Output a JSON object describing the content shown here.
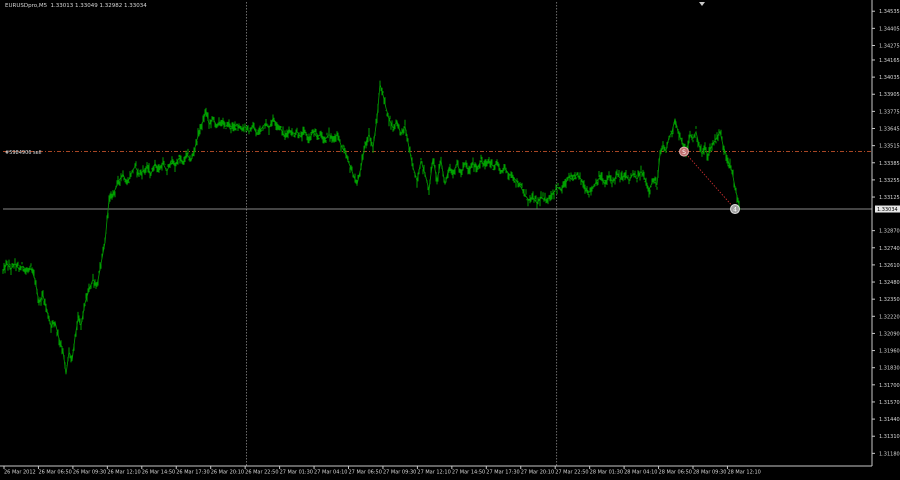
{
  "window": {
    "header": "EURUSDpro,M5  1.33013 1.33049 1.32982 1.33034",
    "order_label": "#5984906 sell",
    "current_price_label": "1.33034"
  },
  "colors": {
    "background": "#000000",
    "candles": "#00a000",
    "axis": "#c8c8c8",
    "text": "#d8d8d8",
    "order_line": "#c0502a",
    "grid": "#9a9a9a"
  },
  "chart_data": {
    "type": "line",
    "title": "",
    "xlabel": "",
    "ylabel": "",
    "ylim": [
      1.31084,
      1.34605
    ],
    "grid": false,
    "y_ticks": [
      "1.34535",
      "1.34405",
      "1.34275",
      "1.34165",
      "1.34035",
      "1.33905",
      "1.33775",
      "1.33645",
      "1.33515",
      "1.33385",
      "1.33255",
      "1.33125",
      "1.32870",
      "1.32740",
      "1.32610",
      "1.32480",
      "1.32350",
      "1.32220",
      "1.32090",
      "1.31960",
      "1.31830",
      "1.31700",
      "1.31570",
      "1.31440",
      "1.31310",
      "1.31180"
    ],
    "y_tick_values": [
      1.34535,
      1.34405,
      1.34275,
      1.34165,
      1.34035,
      1.33905,
      1.33775,
      1.33645,
      1.33515,
      1.33385,
      1.33255,
      1.33125,
      1.3287,
      1.3274,
      1.3261,
      1.3248,
      1.3235,
      1.3222,
      1.3209,
      1.3196,
      1.3183,
      1.317,
      1.3157,
      1.3144,
      1.3131,
      1.3118
    ],
    "x_ticks": [
      "26 Mar 2012",
      "26 Mar 06:50",
      "26 Mar 09:30",
      "26 Mar 12:10",
      "26 Mar 14:50",
      "26 Mar 17:30",
      "26 Mar 20:10",
      "26 Mar 22:50",
      "27 Mar 01:30",
      "27 Mar 04:10",
      "27 Mar 06:50",
      "27 Mar 09:30",
      "27 Mar 12:10",
      "27 Mar 14:50",
      "27 Mar 17:30",
      "27 Mar 20:10",
      "27 Mar 22:50",
      "28 Mar 01:30",
      "28 Mar 04:10",
      "28 Mar 06:50",
      "28 Mar 09:30",
      "28 Mar 12:10"
    ],
    "period_separators": [
      "26 Mar 22:50",
      "27 Mar 22:50"
    ],
    "order_price": 1.3347,
    "current_price": 1.33034,
    "order_open_marker": {
      "label": "S",
      "x": "28 Mar 08:30",
      "y": 1.3347
    },
    "order_close_marker": {
      "label": "4",
      "x": "28 Mar 12:10",
      "y": 1.33034
    },
    "series": [
      {
        "values": [
          [
            0,
            1.3256
          ],
          [
            4,
            1.3262
          ],
          [
            8,
            1.3258
          ],
          [
            12,
            1.3262
          ],
          [
            16,
            1.3258
          ],
          [
            20,
            1.326
          ],
          [
            24,
            1.3256
          ],
          [
            28,
            1.3258
          ],
          [
            32,
            1.325
          ],
          [
            36,
            1.3232
          ],
          [
            40,
            1.3238
          ],
          [
            44,
            1.3226
          ],
          [
            48,
            1.3215
          ],
          [
            52,
            1.3218
          ],
          [
            56,
            1.3205
          ],
          [
            60,
            1.3196
          ],
          [
            63,
            1.3178
          ],
          [
            66,
            1.3195
          ],
          [
            69,
            1.3188
          ],
          [
            72,
            1.3206
          ],
          [
            75,
            1.322
          ],
          [
            78,
            1.3215
          ],
          [
            82,
            1.3232
          ],
          [
            86,
            1.3242
          ],
          [
            90,
            1.325
          ],
          [
            94,
            1.3245
          ],
          [
            98,
            1.3262
          ],
          [
            102,
            1.3278
          ],
          [
            104,
            1.3295
          ],
          [
            106,
            1.331
          ],
          [
            108,
            1.3312
          ],
          [
            112,
            1.3318
          ],
          [
            116,
            1.3325
          ],
          [
            120,
            1.333
          ],
          [
            124,
            1.3322
          ],
          [
            128,
            1.333
          ],
          [
            132,
            1.3336
          ],
          [
            136,
            1.333
          ],
          [
            140,
            1.3332
          ],
          [
            144,
            1.3335
          ],
          [
            148,
            1.333
          ],
          [
            152,
            1.3338
          ],
          [
            156,
            1.3333
          ],
          [
            160,
            1.3338
          ],
          [
            164,
            1.3332
          ],
          [
            168,
            1.334
          ],
          [
            172,
            1.3336
          ],
          [
            176,
            1.3342
          ],
          [
            180,
            1.3338
          ],
          [
            184,
            1.3345
          ],
          [
            188,
            1.334
          ],
          [
            192,
            1.335
          ],
          [
            196,
            1.3362
          ],
          [
            200,
            1.337
          ],
          [
            203,
            1.3378
          ],
          [
            206,
            1.3368
          ],
          [
            210,
            1.3372
          ],
          [
            214,
            1.3366
          ],
          [
            218,
            1.337
          ],
          [
            222,
            1.3366
          ],
          [
            226,
            1.3368
          ],
          [
            230,
            1.3364
          ],
          [
            234,
            1.3368
          ],
          [
            238,
            1.3364
          ],
          [
            242,
            1.3366
          ],
          [
            246,
            1.3362
          ],
          [
            250,
            1.3366
          ],
          [
            254,
            1.336
          ],
          [
            258,
            1.3364
          ],
          [
            262,
            1.3368
          ],
          [
            266,
            1.3365
          ],
          [
            270,
            1.3372
          ],
          [
            274,
            1.3368
          ],
          [
            278,
            1.3364
          ],
          [
            282,
            1.3358
          ],
          [
            286,
            1.3364
          ],
          [
            290,
            1.336
          ],
          [
            294,
            1.3362
          ],
          [
            298,
            1.3358
          ],
          [
            302,
            1.3362
          ],
          [
            306,
            1.3356
          ],
          [
            310,
            1.3362
          ],
          [
            314,
            1.3358
          ],
          [
            318,
            1.336
          ],
          [
            322,
            1.3356
          ],
          [
            326,
            1.336
          ],
          [
            330,
            1.3356
          ],
          [
            334,
            1.336
          ],
          [
            338,
            1.3352
          ],
          [
            342,
            1.3346
          ],
          [
            346,
            1.3338
          ],
          [
            350,
            1.333
          ],
          [
            354,
            1.3322
          ],
          [
            358,
            1.3335
          ],
          [
            362,
            1.3352
          ],
          [
            366,
            1.336
          ],
          [
            370,
            1.335
          ],
          [
            374,
            1.3372
          ],
          [
            377,
            1.3398
          ],
          [
            380,
            1.339
          ],
          [
            383,
            1.338
          ],
          [
            386,
            1.3372
          ],
          [
            390,
            1.3365
          ],
          [
            394,
            1.337
          ],
          [
            398,
            1.336
          ],
          [
            402,
            1.3366
          ],
          [
            406,
            1.335
          ],
          [
            410,
            1.3335
          ],
          [
            414,
            1.3325
          ],
          [
            418,
            1.334
          ],
          [
            422,
            1.333
          ],
          [
            426,
            1.3318
          ],
          [
            430,
            1.3342
          ],
          [
            434,
            1.3325
          ],
          [
            438,
            1.334
          ],
          [
            442,
            1.3322
          ],
          [
            446,
            1.3335
          ],
          [
            450,
            1.333
          ],
          [
            454,
            1.3338
          ],
          [
            458,
            1.333
          ],
          [
            462,
            1.3338
          ],
          [
            466,
            1.3332
          ],
          [
            470,
            1.3338
          ],
          [
            474,
            1.3334
          ],
          [
            478,
            1.334
          ],
          [
            482,
            1.3336
          ],
          [
            486,
            1.334
          ],
          [
            490,
            1.3336
          ],
          [
            494,
            1.3338
          ],
          [
            498,
            1.3332
          ],
          [
            502,
            1.3334
          ],
          [
            506,
            1.333
          ],
          [
            510,
            1.3328
          ],
          [
            514,
            1.3324
          ],
          [
            518,
            1.332
          ],
          [
            522,
            1.3314
          ],
          [
            526,
            1.331
          ],
          [
            530,
            1.3312
          ],
          [
            534,
            1.3308
          ],
          [
            538,
            1.3312
          ],
          [
            542,
            1.331
          ],
          [
            546,
            1.3312
          ],
          [
            550,
            1.3315
          ],
          [
            554,
            1.332
          ],
          [
            558,
            1.3318
          ],
          [
            562,
            1.3322
          ],
          [
            566,
            1.3328
          ],
          [
            570,
            1.3325
          ],
          [
            574,
            1.333
          ],
          [
            578,
            1.3326
          ],
          [
            582,
            1.332
          ],
          [
            586,
            1.3316
          ],
          [
            590,
            1.332
          ],
          [
            594,
            1.3325
          ],
          [
            598,
            1.3328
          ],
          [
            602,
            1.3322
          ],
          [
            606,
            1.3328
          ],
          [
            610,
            1.3324
          ],
          [
            614,
            1.333
          ],
          [
            618,
            1.3326
          ],
          [
            622,
            1.333
          ],
          [
            626,
            1.3325
          ],
          [
            630,
            1.333
          ],
          [
            634,
            1.3326
          ],
          [
            638,
            1.3332
          ],
          [
            642,
            1.3326
          ],
          [
            646,
            1.3318
          ],
          [
            650,
            1.3325
          ],
          [
            654,
            1.3322
          ],
          [
            657,
            1.3345
          ],
          [
            660,
            1.335
          ],
          [
            663,
            1.3348
          ],
          [
            666,
            1.3358
          ],
          [
            669,
            1.3362
          ],
          [
            672,
            1.3372
          ],
          [
            675,
            1.3362
          ],
          [
            678,
            1.3356
          ],
          [
            681,
            1.335
          ],
          [
            684,
            1.3347
          ],
          [
            687,
            1.336
          ],
          [
            690,
            1.3357
          ],
          [
            693,
            1.3362
          ],
          [
            696,
            1.3352
          ],
          [
            699,
            1.3345
          ],
          [
            702,
            1.335
          ],
          [
            705,
            1.3344
          ],
          [
            708,
            1.335
          ],
          [
            711,
            1.3354
          ],
          [
            714,
            1.3358
          ],
          [
            717,
            1.3362
          ],
          [
            720,
            1.3352
          ],
          [
            723,
            1.3345
          ],
          [
            726,
            1.3338
          ],
          [
            729,
            1.3332
          ],
          [
            732,
            1.332
          ],
          [
            735,
            1.331
          ],
          [
            737,
            1.3303
          ]
        ]
      }
    ]
  }
}
